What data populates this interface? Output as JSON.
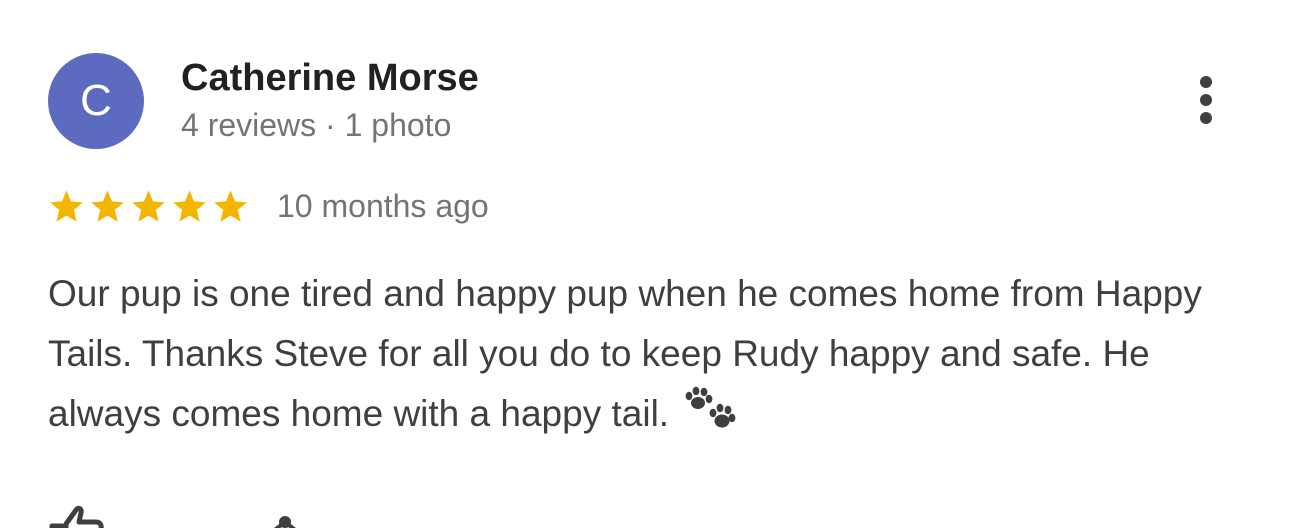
{
  "review": {
    "author": {
      "initial": "C",
      "name": "Catherine Morse",
      "meta": "4 reviews · 1 photo",
      "avatar_color": "#5c6bc0"
    },
    "rating": 5,
    "max_rating": 5,
    "star_color": "#f4b400",
    "time_ago": "10 months ago",
    "text": "Our pup is one tired and happy pup when he comes home from Happy Tails. Thanks Steve for all you do to keep Rudy happy and safe. He always comes home with a happy tail.",
    "trailing_emoji": "paw-prints-icon"
  },
  "actions": {
    "more": "more-vert-icon",
    "like": "thumb-up-icon",
    "share": "share-icon"
  }
}
